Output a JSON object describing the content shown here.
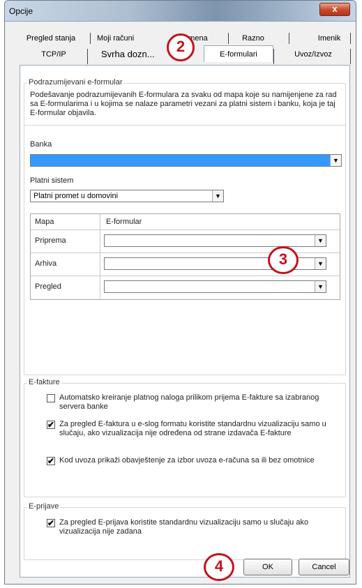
{
  "window": {
    "title": "Opcije",
    "close_glyph": "x"
  },
  "tabs_top": [
    "Pregled stanja",
    "Moji računi",
    "...mena",
    "Razno",
    "Imenik"
  ],
  "tabs_bottom": [
    "TCP/IP",
    "Svrha dozn...",
    "E-formulari",
    "Uvoz/Izvoz"
  ],
  "default_form_group": {
    "title": "Podrazumijevani e-formular",
    "description": "Podešavanje podrazumijevanih E-formulara za svaku od mapa koje su namijenjene za rad sa E-formularima i u kojima se nalaze parametri vezani za platni sistem i banku, koja je taj E-formular objavila.",
    "bank_label": "Banka",
    "bank_value": "",
    "payment_label": "Platni sistem",
    "payment_value": "Platni promet u domovini",
    "table_headers": [
      "Mapa",
      "E-formular"
    ],
    "table_rows": [
      {
        "folder": "Priprema",
        "form": ""
      },
      {
        "folder": "Arhiva",
        "form": ""
      },
      {
        "folder": "Pregled",
        "form": ""
      }
    ]
  },
  "efakture_group": {
    "title": "E-fakture",
    "options": [
      {
        "checked": false,
        "text": "Automatsko kreiranje platnog naloga prilikom prijema E-fakture sa izabranog servera banke"
      },
      {
        "checked": true,
        "text": "Za pregled E-faktura u e-slog formatu koristite standardnu vizualizaciju samo u slučaju, ako vizualizacija nije određena od strane izdavača E-fakture"
      },
      {
        "checked": true,
        "text": "Kod uvoza prikaži obavještenje za izbor uvoza e-računa sa ili bez omotnice"
      }
    ]
  },
  "eprijave_group": {
    "title": "E-prijave",
    "options": [
      {
        "checked": true,
        "text": "Za pregled E-prijava koristite standardnu vizualizaciju samo u slučaju ako vizualizacija nije zadana"
      }
    ]
  },
  "buttons": {
    "ok": "OK",
    "cancel": "Cancel"
  },
  "callouts": [
    "2",
    "3",
    "4"
  ],
  "glyphs": {
    "check": "✔",
    "dropdown": "▼"
  },
  "colors": {
    "callout_red": "#c4121b",
    "selection_blue": "#3399ff"
  }
}
